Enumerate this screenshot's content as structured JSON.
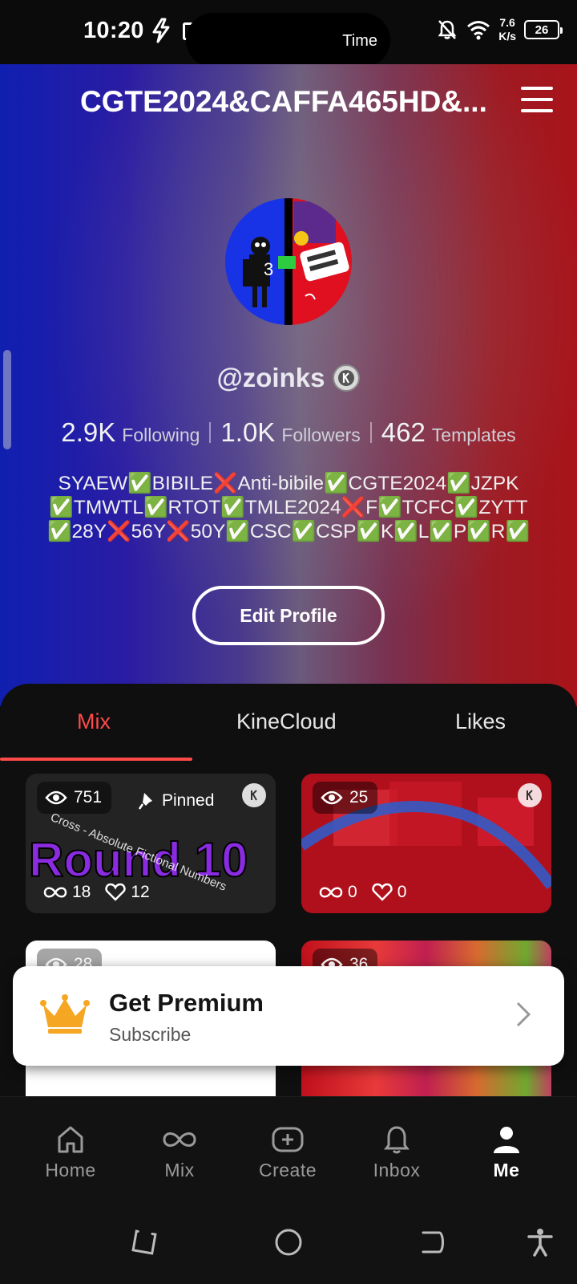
{
  "status_bar": {
    "time": "10:20",
    "pill_label": "Time",
    "net_speed_value": "7.6",
    "net_speed_unit": "K/s",
    "battery": "26"
  },
  "header": {
    "title": "CGTE2024&CAFFA465HD&...",
    "username": "@zoinks",
    "avatar_number": "3",
    "stats": [
      {
        "value": "2.9K",
        "label": "Following"
      },
      {
        "value": "1.0K",
        "label": "Followers"
      },
      {
        "value": "462",
        "label": "Templates"
      }
    ],
    "bio_lines": [
      "SYAEW✅BIBILE❌Anti-bibile✅CGTE2024✅JZPK",
      "✅TMWTL✅RTOT✅TMLE2024❌F✅TCFC✅ZYTT",
      "✅28Y❌56Y❌50Y✅CSC✅CSP✅K✅L✅P✅R✅"
    ],
    "edit_profile_label": "Edit Profile"
  },
  "tabs": [
    {
      "label": "Mix",
      "active": true
    },
    {
      "label": "KineCloud",
      "active": false
    },
    {
      "label": "Likes",
      "active": false
    }
  ],
  "cards": [
    {
      "views": "751",
      "pinned_label": "Pinned",
      "remixes": "18",
      "likes": "12",
      "thumb_title": "Round 10",
      "thumb_caption": "Cross - Absolute Fictional Numbers"
    },
    {
      "views": "25",
      "remixes": "0",
      "likes": "0"
    },
    {
      "views": "28"
    },
    {
      "views": "36"
    }
  ],
  "premium": {
    "title": "Get Premium",
    "subtitle": "Subscribe",
    "crown_color": "#f5a623"
  },
  "bottom_nav": [
    {
      "label": "Home",
      "icon": "home-icon"
    },
    {
      "label": "Mix",
      "icon": "mix-icon"
    },
    {
      "label": "Create",
      "icon": "create-icon"
    },
    {
      "label": "Inbox",
      "icon": "bell-icon"
    },
    {
      "label": "Me",
      "icon": "person-icon",
      "active": true
    }
  ],
  "colors": {
    "accent": "#ff4a4a",
    "header_left": "#101fb0",
    "header_right": "#a8141a"
  }
}
